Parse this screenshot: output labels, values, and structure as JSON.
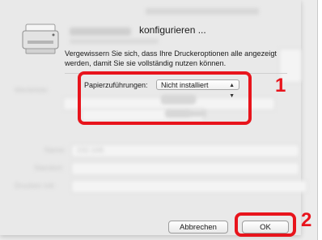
{
  "dialog": {
    "title_suffix": "konfigurieren ...",
    "instruction": "Vergewissern Sie sich, dass Ihre Druckeroptionen alle angezeigt werden, damit Sie sie vollständig nutzen können."
  },
  "options": {
    "paper_feed_label": "Papierzuführungen:",
    "paper_feed_value": "Nicht installiert"
  },
  "background": {
    "name_label": "Name:",
    "name_value": "192.168.",
    "location_label": "Standort:",
    "print_with_label": "Drucken mit:",
    "left_label": "Werteliste:"
  },
  "buttons": {
    "cancel": "Abbrechen",
    "ok": "OK"
  },
  "callouts": {
    "step1": "1",
    "step2": "2"
  },
  "colors": {
    "highlight": "#e8141c"
  }
}
